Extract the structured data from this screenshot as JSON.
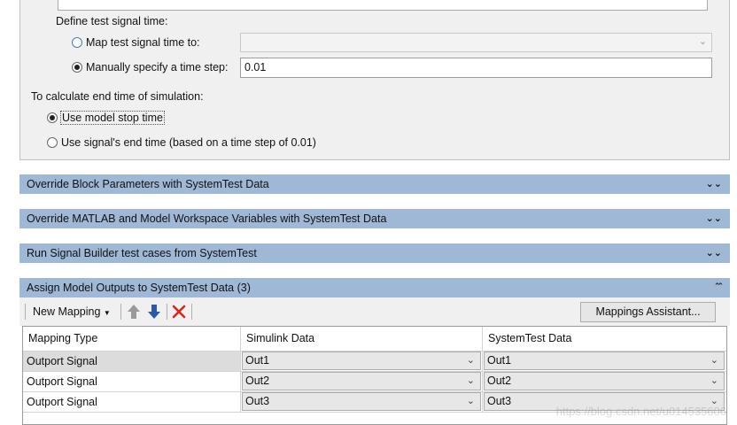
{
  "signal_time": {
    "define_label": "Define test signal time:",
    "map_label": "Map test signal time to:",
    "map_value": "",
    "manual_label": "Manually specify a time step:",
    "manual_value": "0.01"
  },
  "end_time": {
    "label": "To calculate end time of simulation:",
    "use_model_stop": "Use model stop time",
    "use_signal_end": "Use signal's end time (based on a time step of 0.01)"
  },
  "sections": [
    {
      "label": "Override Block Parameters with SystemTest Data",
      "state": "collapsed"
    },
    {
      "label": "Override MATLAB and Model Workspace Variables with SystemTest Data",
      "state": "collapsed"
    },
    {
      "label": "Run Signal Builder test cases from SystemTest",
      "state": "collapsed"
    },
    {
      "label": "Assign Model Outputs to SystemTest Data (3)",
      "state": "expanded"
    }
  ],
  "toolbar": {
    "new_mapping": "New Mapping",
    "mappings_assistant": "Mappings Assistant..."
  },
  "table": {
    "headers": [
      "Mapping Type",
      "Simulink Data",
      "SystemTest Data"
    ],
    "rows": [
      {
        "type": "Outport Signal",
        "simulink": "Out1",
        "systemtest": "Out1"
      },
      {
        "type": "Outport Signal",
        "simulink": "Out2",
        "systemtest": "Out2"
      },
      {
        "type": "Outport Signal",
        "simulink": "Out3",
        "systemtest": "Out3"
      }
    ]
  },
  "watermark": "https://blog.csdn.net/u014535606",
  "colors": {
    "section_header": "#9fb8d6",
    "panel_bg": "#f0f0f0",
    "delete_icon": "#d9261c",
    "arrow_up": "#9a9a9a",
    "arrow_down": "#2b5aa8"
  }
}
